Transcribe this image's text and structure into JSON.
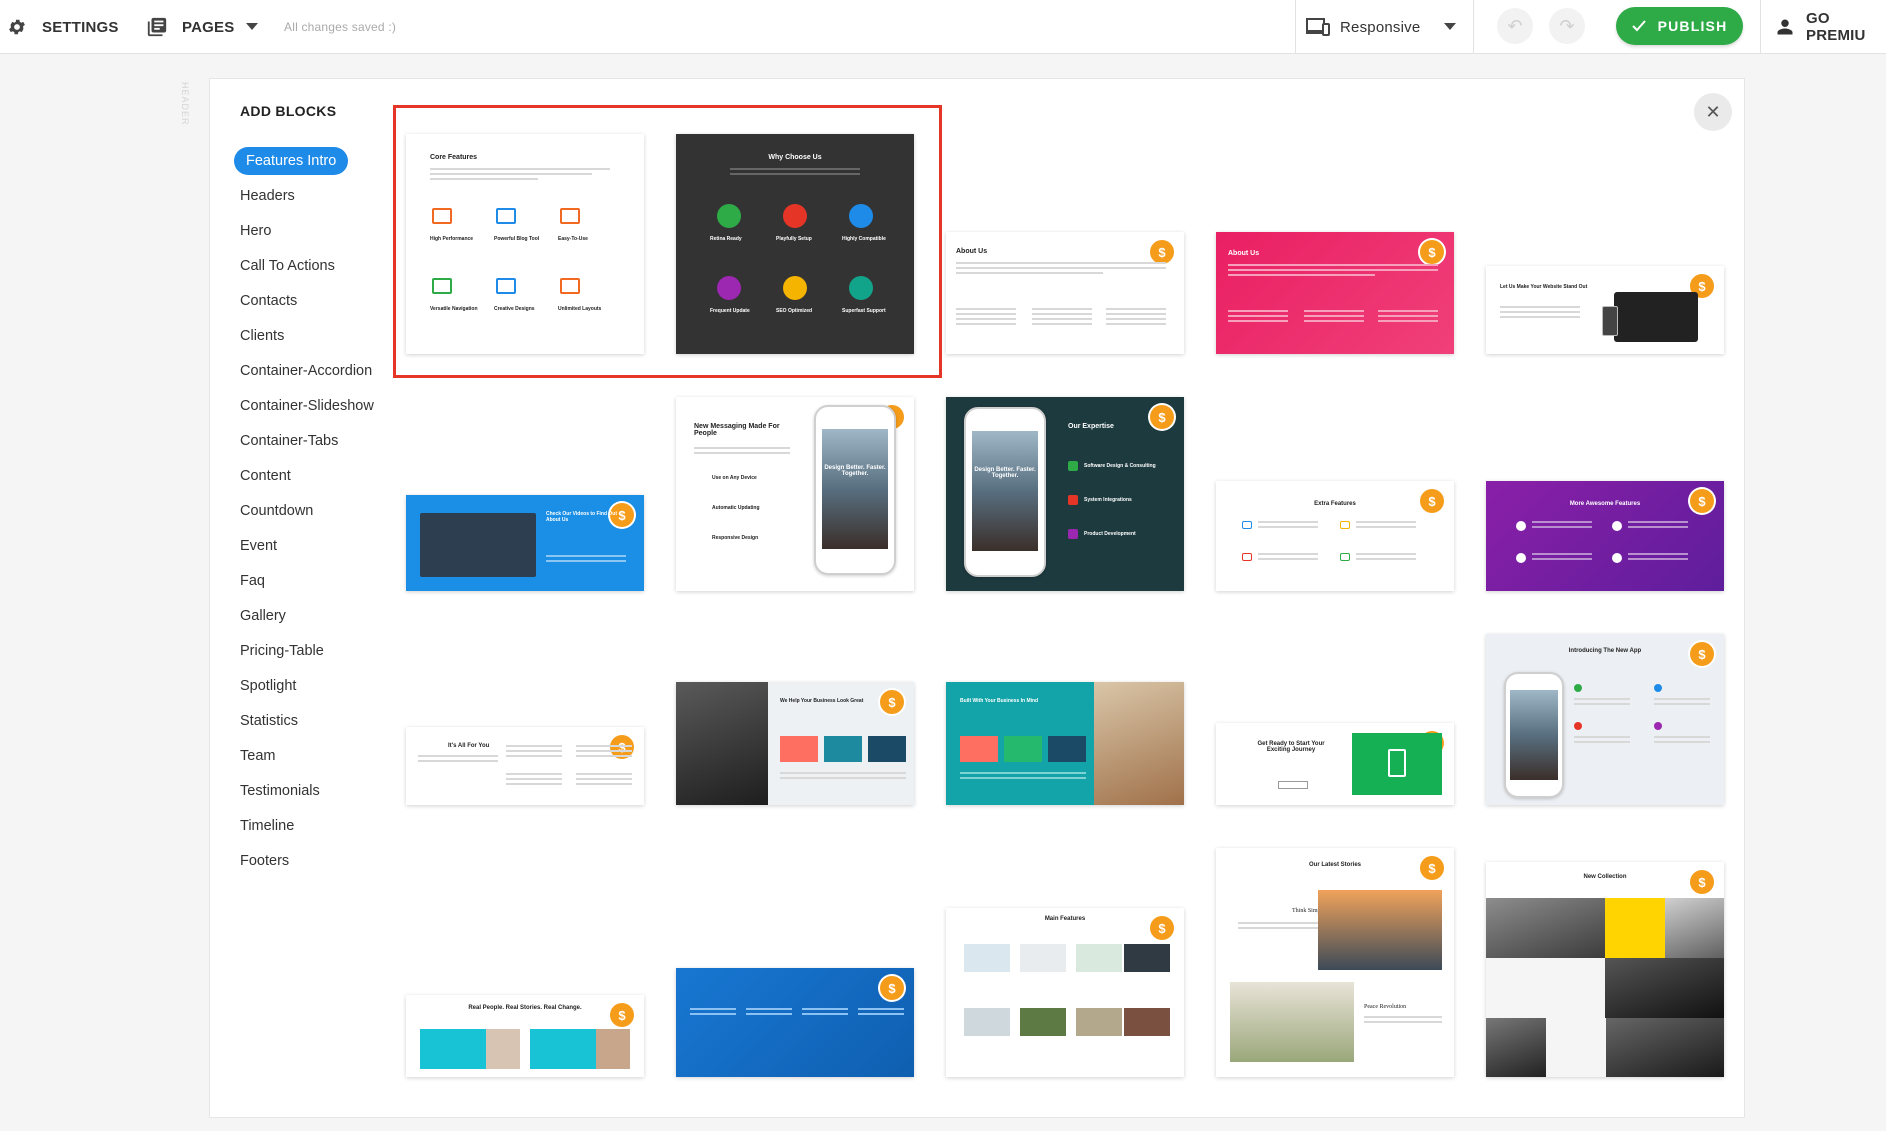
{
  "topbar": {
    "settings_label": "SETTINGS",
    "pages_label": "PAGES",
    "saved_status": "All changes saved :)",
    "responsive_label": "Responsive",
    "publish_label": "PUBLISH",
    "premium_label": "GO PREMIU"
  },
  "ghost_label": "HEADER",
  "panel": {
    "title": "ADD BLOCKS",
    "categories": [
      "Features Intro",
      "Headers",
      "Hero",
      "Call To Actions",
      "Contacts",
      "Clients",
      "Container-Accordion",
      "Container-Slideshow",
      "Container-Tabs",
      "Content",
      "Countdown",
      "Event",
      "Faq",
      "Gallery",
      "Pricing-Table",
      "Spotlight",
      "Statistics",
      "Team",
      "Testimonials",
      "Timeline",
      "Footers"
    ],
    "active_category": "Features Intro"
  },
  "thumbs": {
    "core_features": {
      "title": "Core Features",
      "items": [
        "High Performance",
        "Powerful Blog Tool",
        "Easy-To-Use",
        "Versatile Navigation",
        "Creative Designs",
        "Unlimited Layouts"
      ]
    },
    "why_choose": {
      "title": "Why Choose Us",
      "items": [
        "Retina Ready",
        "Playfully Setup",
        "Highly Compatible",
        "Frequent Update",
        "SEO Optimized",
        "Superfast Support"
      ]
    },
    "about_white": {
      "title": "About Us"
    },
    "about_pink": {
      "title": "About Us"
    },
    "stand_out": {
      "title": "Let Us Make Your Website Stand Out"
    },
    "videos": {
      "title": "Check Our Videos to Find Out About Us"
    },
    "messaging": {
      "title": "New Messaging Made For People",
      "items": [
        "Use on Any Device",
        "Automatic Updating",
        "Responsive Design"
      ]
    },
    "expertise": {
      "title": "Our Expertise",
      "items": [
        "Software Design & Consulting",
        "System Integrations",
        "Product Development"
      ]
    },
    "extra": {
      "title": "Extra Features"
    },
    "awesome": {
      "title": "More Awesome Features"
    },
    "all_for_you": {
      "title": "It's All For You"
    },
    "business": {
      "title": "We Help Your Business Look Great"
    },
    "built": {
      "title": "Built With Your Business In Mind"
    },
    "journey": {
      "title": "Get Ready to Start Your Exciting Journey"
    },
    "new_app": {
      "title": "Introducing The New App"
    },
    "real_people": {
      "title": "Real People. Real Stories. Real Change."
    },
    "main_features": {
      "title": "Main Features"
    },
    "latest_stories": {
      "title": "Our Latest Stories",
      "story1": "Think Simple Now",
      "story2": "Peace Revolution"
    },
    "collection": {
      "title": "New Collection"
    },
    "phone_caption": "Design Better. Faster. Together."
  },
  "colors": {
    "accent": "#1f8be8",
    "publish": "#2eaa47",
    "coin": "#f59c1a",
    "selection": "#e53527",
    "pink": "#e91e63",
    "purple": "#7b1fa2",
    "teal": "#12a4a8"
  }
}
